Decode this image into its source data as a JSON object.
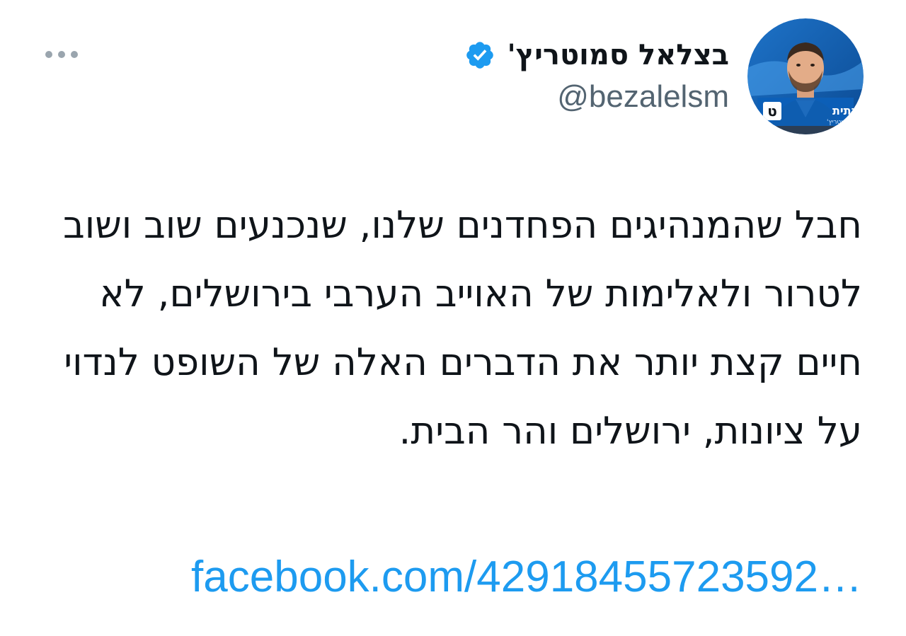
{
  "tweet": {
    "author": {
      "display_name": "בצלאל סמוטריץ'",
      "handle": "@bezalelsm",
      "verified": true,
      "verified_icon": "verified-badge-icon",
      "avatar_badge_text": "הציונות הדתית",
      "avatar_badge_subtext": "בצלאל סמוטריץ'",
      "avatar_letter": "ט"
    },
    "more_icon": "more-dots-icon",
    "text": "חבל שהמנהיגים הפחדנים שלנו, שנכנעים שוב ושוב לטרור ולאלימות של האוייב הערבי בירושלים, לא חיים קצת יותר את הדברים האלה של השופט לנדוי על ציונות, ירושלים והר הבית.",
    "link_text": "facebook.com/42918455723592…"
  },
  "colors": {
    "text_primary": "#0f1419",
    "text_secondary": "#536471",
    "link": "#1d9bf0",
    "verified": "#1d9bf0",
    "more_dots": "#9aa5ae",
    "background": "#ffffff"
  }
}
